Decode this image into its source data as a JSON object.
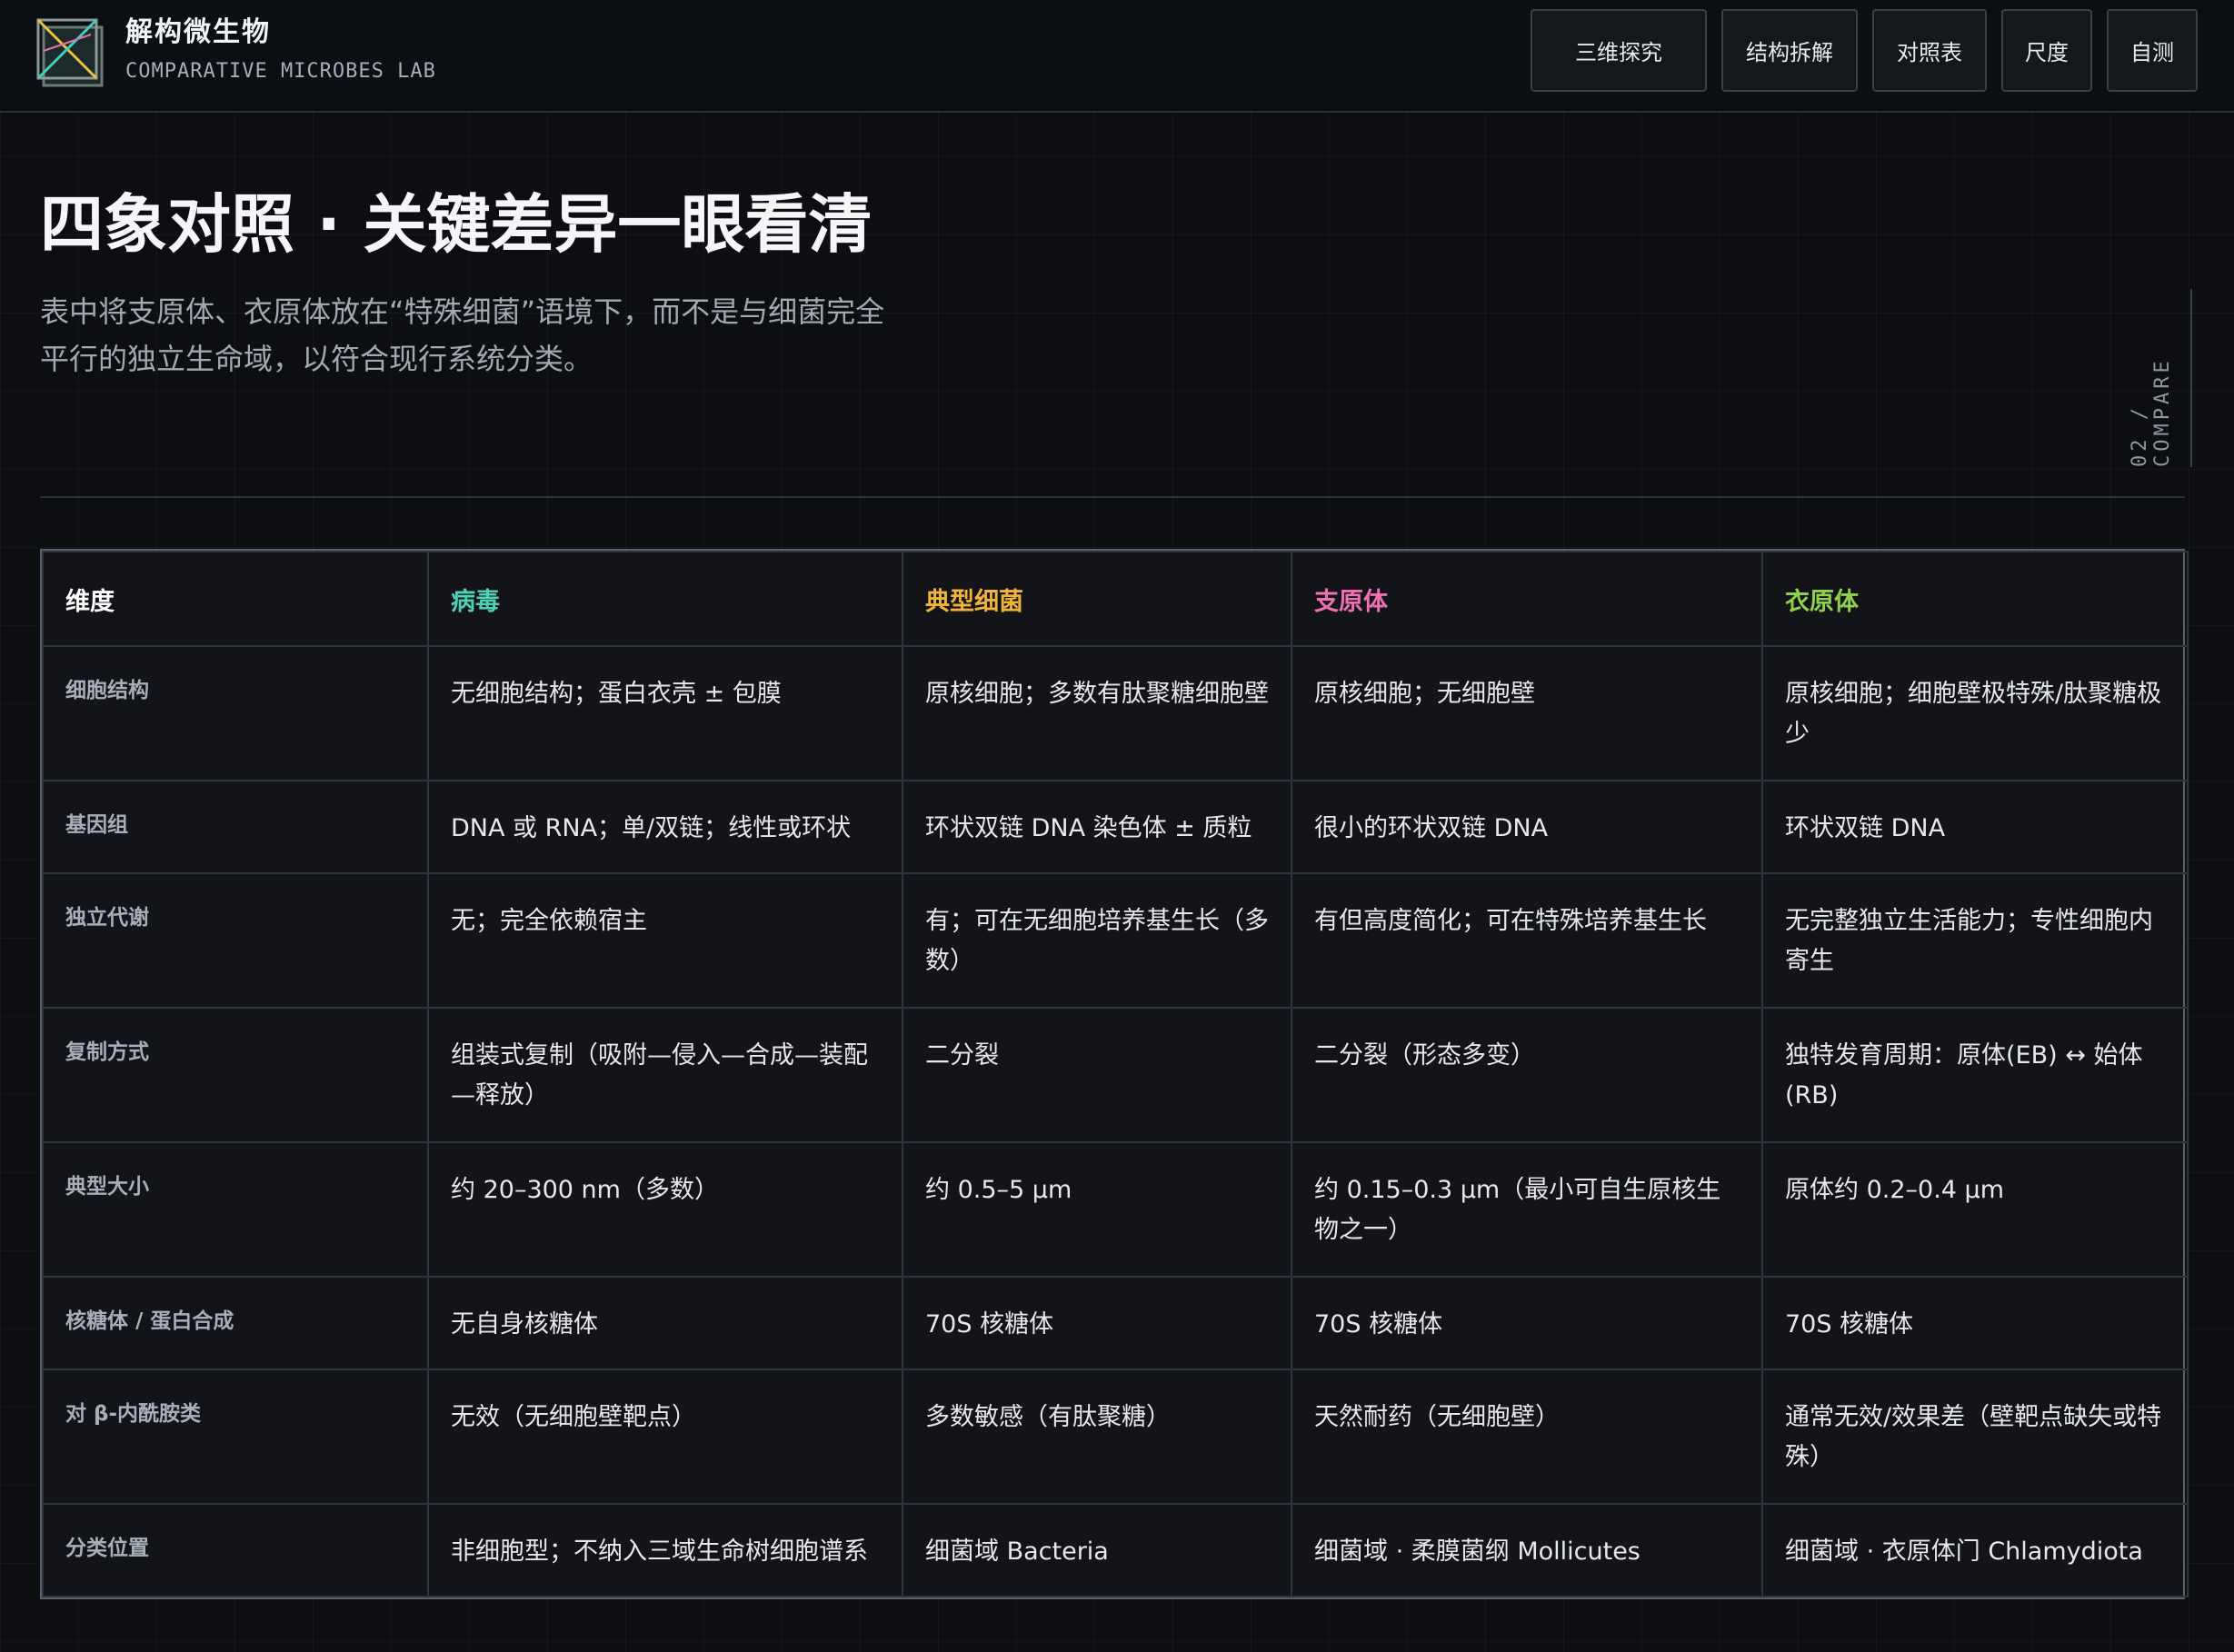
{
  "brand": {
    "title": "解构微生物",
    "subtitle": "COMPARATIVE MICROBES LAB",
    "logo_icon": "wireframe-box-logo-icon"
  },
  "nav": [
    "三维探究",
    "结构拆解",
    "对照表",
    "尺度",
    "自测"
  ],
  "hero": {
    "title": "四象对照 · 关键差异一眼看清",
    "description": "表中将支原体、衣原体放在“特殊细菌”语境下，而不是与细菌完全平行的独立生命域，以符合现行系统分类。",
    "side_tag": "02 / COMPARE"
  },
  "colors": {
    "virus": "#4fd1b5",
    "bacteria": "#f0b43c",
    "mycoplasma": "#f06fb5",
    "chlamydia": "#8fd14a"
  },
  "table": {
    "headers": [
      "维度",
      "病毒",
      "典型细菌",
      "支原体",
      "衣原体"
    ],
    "rows": [
      {
        "dim": "细胞结构",
        "cells": [
          "无细胞结构；蛋白衣壳 ± 包膜",
          "原核细胞；多数有肽聚糖细胞壁",
          "原核细胞；无细胞壁",
          "原核细胞；细胞壁极特殊/肽聚糖极少"
        ]
      },
      {
        "dim": "基因组",
        "cells": [
          "DNA 或 RNA；单/双链；线性或环状",
          "环状双链 DNA 染色体 ± 质粒",
          "很小的环状双链 DNA",
          "环状双链 DNA"
        ]
      },
      {
        "dim": "独立代谢",
        "cells": [
          "无；完全依赖宿主",
          "有；可在无细胞培养基生长（多数）",
          "有但高度简化；可在特殊培养基生长",
          "无完整独立生活能力；专性细胞内寄生"
        ]
      },
      {
        "dim": "复制方式",
        "cells": [
          "组装式复制（吸附—侵入—合成—装配—释放）",
          "二分裂",
          "二分裂（形态多变）",
          "独特发育周期：原体(EB) ↔ 始体(RB)"
        ]
      },
      {
        "dim": "典型大小",
        "cells": [
          "约 20–300 nm（多数）",
          "约 0.5–5 µm",
          "约 0.15–0.3 µm（最小可自生原核生物之一）",
          "原体约 0.2–0.4 µm"
        ]
      },
      {
        "dim": "核糖体 / 蛋白合成",
        "cells": [
          "无自身核糖体",
          "70S 核糖体",
          "70S 核糖体",
          "70S 核糖体"
        ]
      },
      {
        "dim": "对 β-内酰胺类",
        "cells": [
          "无效（无细胞壁靶点）",
          "多数敏感（有肽聚糖）",
          "天然耐药（无细胞壁）",
          "通常无效/效果差（壁靶点缺失或特殊）"
        ]
      },
      {
        "dim": "分类位置",
        "cells": [
          "非细胞型；不纳入三域生命树细胞谱系",
          "细菌域 Bacteria",
          "细菌域 · 柔膜菌纲 Mollicutes",
          "细菌域 · 衣原体门 Chlamydiota"
        ]
      }
    ]
  }
}
